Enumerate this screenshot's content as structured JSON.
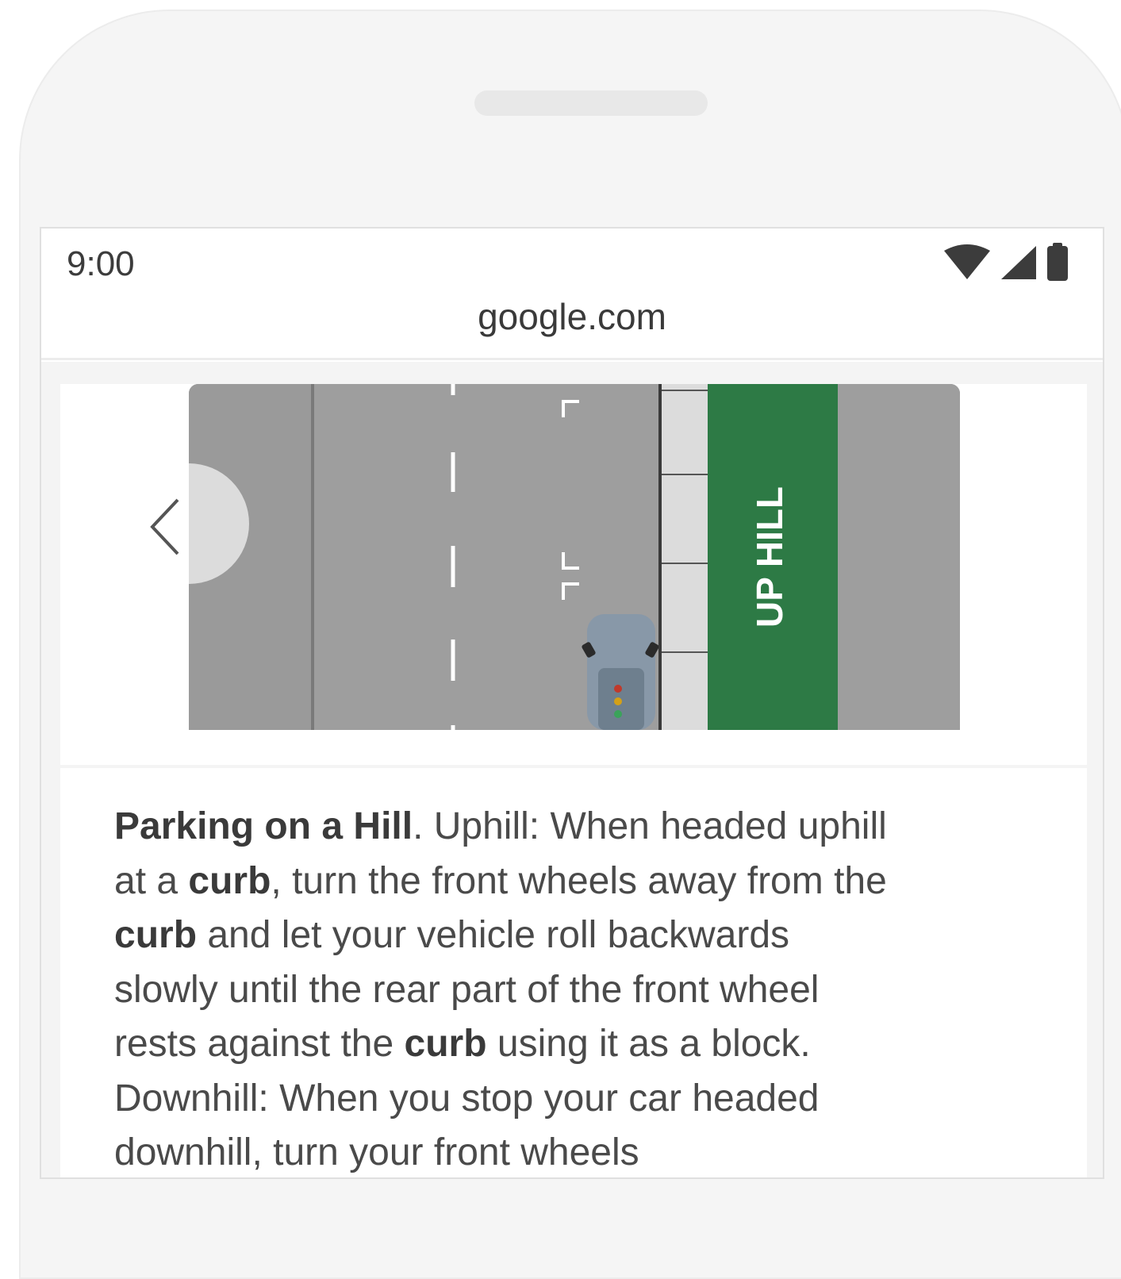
{
  "status_bar": {
    "time": "9:00",
    "icons": [
      "wifi-icon",
      "signal-icon",
      "battery-icon"
    ]
  },
  "browser": {
    "url": "google.com"
  },
  "result": {
    "image_label": "UP HILL",
    "snippet": {
      "title": "Parking on a Hill",
      "t1": ". Uphill: When headed uphill at a ",
      "b1": "curb",
      "t2": ", turn the front wheels away from the ",
      "b2": "curb",
      "t3": " and let your vehicle roll backwards slowly until the rear part of the front wheel rests against the ",
      "b3": "curb",
      "t4": " using it as a block. Downhill: When you stop your car headed downhill, turn your front wheels"
    }
  },
  "colors": {
    "hill_green": "#2d7a45",
    "road_gray": "#9e9e9e",
    "curb_light": "#dcdcdc"
  }
}
